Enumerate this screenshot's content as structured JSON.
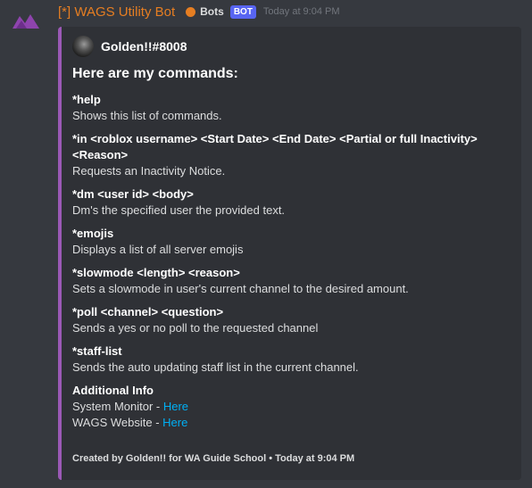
{
  "message": {
    "username": "[*] WAGS Utility Bot",
    "role_label": "Bots",
    "bot_tag": "BOT",
    "timestamp": "Today at 9:04 PM",
    "username_color": "#e67e22",
    "embed_color": "#9b59b6"
  },
  "embed": {
    "author": "Golden!!#8008",
    "title": "Here are my commands:",
    "fields": [
      {
        "name": "*help",
        "value": "Shows this list of commands."
      },
      {
        "name": "*in <roblox username> <Start Date> <End Date> <Partial or full Inactivity> <Reason>",
        "value": "Requests an Inactivity Notice."
      },
      {
        "name": "*dm <user id> <body>",
        "value": "Dm's the specified user the provided text."
      },
      {
        "name": "*emojis",
        "value": "Displays a list of all server emojis"
      },
      {
        "name": "*slowmode <length> <reason>",
        "value": "Sets a slowmode in user's current channel to the desired amount."
      },
      {
        "name": "*poll <channel> <question>",
        "value": "Sends a yes or no poll to the requested channel"
      },
      {
        "name": "*staff-list",
        "value": "Sends the auto updating staff list in the current channel."
      }
    ],
    "additional": {
      "name": "Additional Info",
      "lines": [
        {
          "prefix": "System Monitor - ",
          "link": "Here"
        },
        {
          "prefix": "WAGS Website - ",
          "link": "Here"
        }
      ]
    },
    "footer": "Created by Golden!! for WA Guide School • Today at 9:04 PM"
  }
}
